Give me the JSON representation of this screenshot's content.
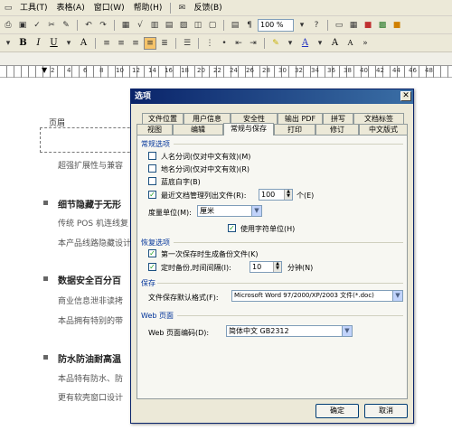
{
  "menubar": {
    "items": [
      "工具(T)",
      "表格(A)",
      "窗口(W)",
      "帮助(H)",
      "反馈(B)"
    ]
  },
  "toolbar": {
    "zoom": "100 %"
  },
  "ruler": {
    "numbers": [
      "2",
      "4",
      "6",
      "8",
      "10",
      "12",
      "14",
      "16",
      "18",
      "20",
      "22",
      "24",
      "26",
      "28",
      "30",
      "32",
      "34",
      "36",
      "38",
      "40",
      "42",
      "44",
      "46",
      "48"
    ]
  },
  "document": {
    "header_label": "页眉",
    "line1": "超强扩展性与兼容",
    "heading1": "细节隐藏于无形",
    "line2": "传统 POS 机连线复",
    "line3": "本产品线路隐藏设计",
    "heading2": "数据安全百分百",
    "line4": "商业信息泄非读拷",
    "line5": "本品拥有特别的带",
    "heading3": "防水防油耐高温",
    "line6": "本品特有防水、防",
    "line7": "更有软壳窗口设计"
  },
  "dialog": {
    "title": "选项",
    "tabs_row1": [
      "文件位置",
      "用户信息",
      "安全性",
      "输出 PDF",
      "拼写",
      "文档标签"
    ],
    "tabs_row2": [
      "视图",
      "编辑",
      "常规与保存",
      "打印",
      "修订",
      "中文版式"
    ],
    "section_general": "常规选项",
    "opt1": "人名分词(仅对中文有效)(M)",
    "opt2": "地名分词(仅对中文有效)(R)",
    "opt3": "蓝底白字(B)",
    "opt4": "最近文档管理列出文件(R):",
    "recent_count": "100",
    "recent_unit": "个(E)",
    "measure_label": "度量单位(M):",
    "measure_value": "厘米",
    "opt5": "使用字符单位(H)",
    "section_backup": "恢复选项",
    "opt6": "第一次保存时生成备份文件(K)",
    "opt7": "定时备份,时间间隔(I):",
    "interval": "10",
    "interval_unit": "分钟(N)",
    "section_save": "保存",
    "format_label": "文件保存默认格式(F):",
    "format_value": "Microsoft Word 97/2000/XP/2003 文件(*.doc)",
    "section_web": "Web 页面",
    "encoding_label": "Web 页面编码(D):",
    "encoding_value": "简体中文 GB2312",
    "ok": "确定",
    "cancel": "取消"
  },
  "colors": {
    "accent": "#0a246a",
    "chrome": "#ece9d8"
  }
}
